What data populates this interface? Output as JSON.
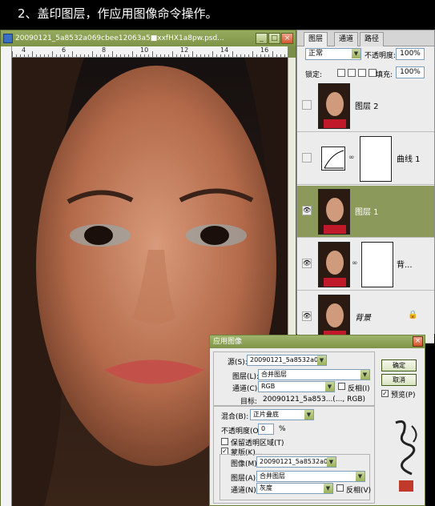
{
  "caption": "2、盖印图层，作应用图像命令操作。",
  "document": {
    "title": "20090121_5a8532a069cbee12063a5■xxfHX1a8pw.psd...",
    "ruler_numbers": [
      "4",
      "6",
      "8",
      "10",
      "12",
      "14",
      "16"
    ],
    "win_buttons": [
      "_",
      "□",
      "×"
    ]
  },
  "layers_panel": {
    "tabs": [
      "图层",
      "通道",
      "路径"
    ],
    "blend_mode": "正常",
    "opacity_label": "不透明度:",
    "opacity_value": "100%",
    "lock_label": "锁定:",
    "fill_label": "填充:",
    "fill_value": "100%",
    "layers": [
      {
        "name": "图层 2",
        "visible": false,
        "selected": false
      },
      {
        "name": "曲线 1",
        "visible": false,
        "selected": false
      },
      {
        "name": "图层 1",
        "visible": true,
        "selected": true
      },
      {
        "name": "背...",
        "visible": true,
        "selected": false
      },
      {
        "name": "背景",
        "visible": true,
        "selected": false
      }
    ]
  },
  "apply_image_dialog": {
    "title": "应用图像",
    "source_label": "源(S):",
    "source_value": "20090121_5a8532a069...",
    "layer_label": "图层(L):",
    "layer_value": "合并图层",
    "channel_label": "通道(C):",
    "channel_value": "RGB",
    "invert_label": "反相(I)",
    "target_label": "目标:",
    "target_value": "20090121_5a853...(..., RGB)",
    "blending_label": "混合(B):",
    "blending_value": "正片叠底",
    "opacity_label": "不透明度(O):",
    "opacity_value": "0",
    "opacity_unit": "%",
    "preserve_label": "保留透明区域(T)",
    "mask_label": "蒙版(K)...",
    "image_label": "图像(M):",
    "image_value": "20090121_5a8532a069...",
    "mask_layer_label": "图层(A):",
    "mask_layer_value": "合并图层",
    "mask_channel_label": "通道(N):",
    "mask_channel_value": "灰度",
    "mask_invert_label": "反相(V)",
    "ok_label": "确定",
    "cancel_label": "取消",
    "preview_label": "预览(P)"
  },
  "colors": {
    "titlebar": "#8ea25a",
    "selected_layer": "#8b9a5b",
    "dialog_bg": "#ececec"
  }
}
